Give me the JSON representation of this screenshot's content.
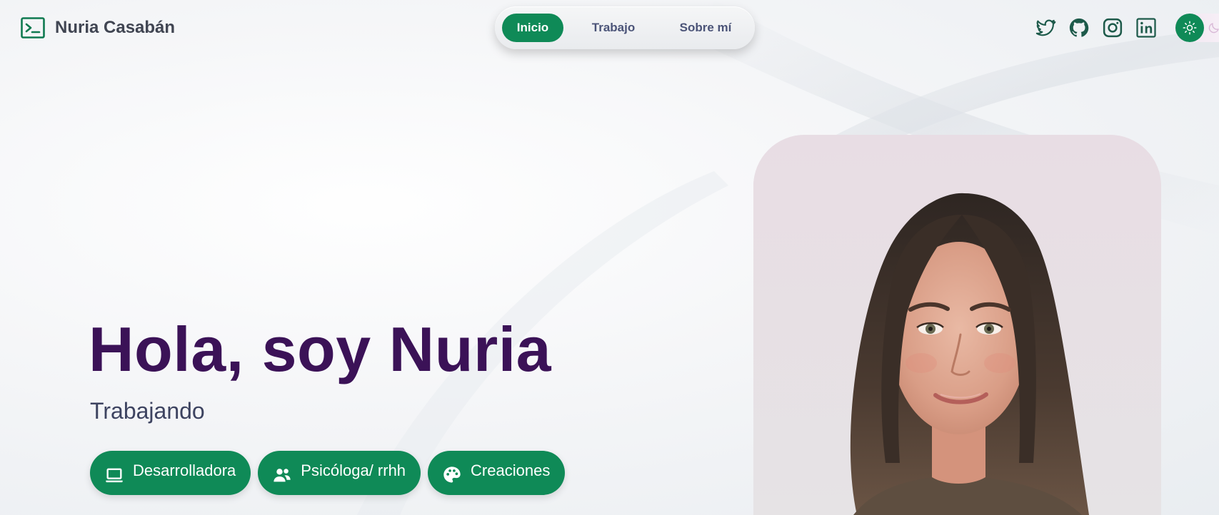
{
  "header": {
    "brand_name": "Nuria Casabán",
    "brand_icon": "terminal-icon",
    "nav": [
      {
        "label": "Inicio",
        "active": true
      },
      {
        "label": "Trabajo",
        "active": false
      },
      {
        "label": "Sobre mí",
        "active": false
      }
    ],
    "socials": [
      "twitter-icon",
      "github-icon",
      "instagram-icon",
      "linkedin-icon"
    ],
    "theme_toggle": {
      "current": "light",
      "icons": [
        "sun-icon",
        "moon-icon"
      ]
    }
  },
  "hero": {
    "title": "Hola, soy Nuria",
    "subtitle": "Trabajando",
    "chips": [
      {
        "label": "Desarrolladora",
        "icon": "laptop-icon"
      },
      {
        "label": "Psicóloga/ rrhh",
        "icon": "users-icon"
      },
      {
        "label": "Creaciones",
        "icon": "palette-icon"
      }
    ]
  },
  "colors": {
    "accent": "#0f8a57",
    "title": "#3b1257",
    "subtitle": "#3d4360",
    "nav_text": "#4b5478"
  }
}
